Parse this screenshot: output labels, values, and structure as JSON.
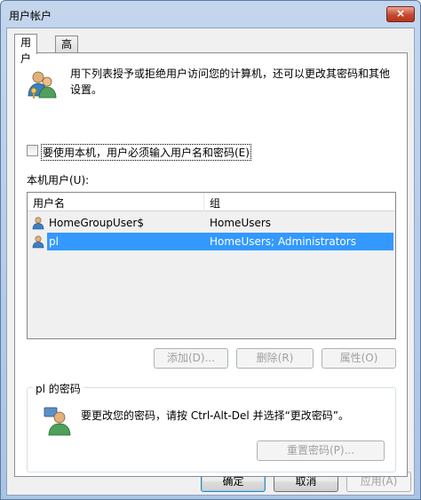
{
  "window": {
    "title": "用户帐户",
    "close_label": "×"
  },
  "tabs": [
    {
      "label": "用户"
    },
    {
      "label": "高级"
    }
  ],
  "users_tab": {
    "info_text": "用下列表授予或拒绝用户访问您的计算机，还可以更改其密码和其他设置。",
    "require_login_label": "要使用本机，用户必须输入用户名和密码(E)",
    "require_login_checked": false,
    "list_label": "本机用户(U):",
    "columns": {
      "name": "用户名",
      "group": "组"
    },
    "rows": [
      {
        "name": "HomeGroupUser$",
        "group": "HomeUsers"
      },
      {
        "name": "pl",
        "group": "HomeUsers; Administrators"
      }
    ],
    "selected_row": 1,
    "buttons": {
      "add": "添加(D)...",
      "remove": "删除(R)",
      "properties": "属性(O)"
    },
    "password_group": {
      "title": "pl 的密码",
      "text": "要更改您的密码，请按 Ctrl-Alt-Del 并选择“更改密码”。",
      "reset_button": "重置密码(P)..."
    }
  },
  "footer": {
    "ok": "确定",
    "cancel": "取消",
    "apply": "应用(A)"
  },
  "icons": {
    "users": "users-icon",
    "user_row": "user-icon",
    "password_user": "user-password-icon"
  }
}
